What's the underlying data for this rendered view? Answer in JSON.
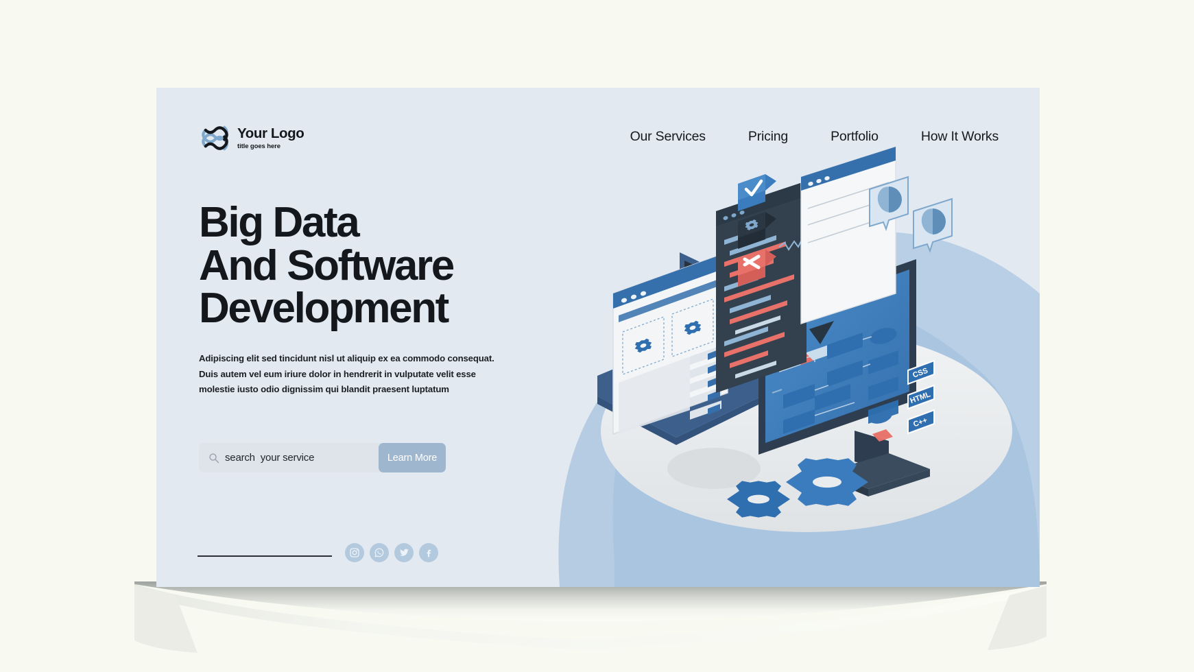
{
  "page": {
    "background_color": "#f8faf1",
    "card_color": "#e3e9f1"
  },
  "brand": {
    "logo_icon": "interlocking-loops-logo",
    "title": "Your Logo",
    "subtitle": "title goes here",
    "logo_color_light": "#7fa8cc",
    "logo_color_dark": "#14181c"
  },
  "nav": {
    "items": [
      {
        "label": "Our Services"
      },
      {
        "label": "Pricing"
      },
      {
        "label": "Portfolio"
      },
      {
        "label": "How It Works"
      }
    ]
  },
  "hero": {
    "title_lines": [
      "Big Data",
      "And Software",
      "Development"
    ],
    "description": "Adipiscing elit sed  tincidunt nisl ut aliquip ex ea commodo consequat. Duis autem vel eum iriure dolor in hendrerit in vulputate velit esse molestie iusto odio dignissim qui blandit praesent luptatum",
    "search": {
      "icon": "search-icon",
      "placeholder": "search  your service",
      "value": "",
      "button_label": "Learn More",
      "button_color": "#9fb6cf",
      "field_color": "#dfe4ea"
    },
    "social": [
      {
        "name": "instagram",
        "label": "Instagram"
      },
      {
        "name": "whatsapp",
        "label": "WhatsApp"
      },
      {
        "name": "twitter",
        "label": "Twitter"
      },
      {
        "name": "facebook",
        "label": "Facebook"
      }
    ],
    "social_color": "#b3c9de",
    "divider_color": "#2b3038"
  },
  "illustration": {
    "name": "isometric-software-development-scene",
    "blob_back_color": "#b9cfe5",
    "blob_front_color": "#a6c2de",
    "desk_color": "#e9ecee",
    "monitor_frame_color": "#2e3d4f",
    "monitor_screen_color": "#3a7cbe",
    "laptop_color": "#3c5f8c",
    "code_window_color": "#33414f",
    "gear_color": "#3a7cbe",
    "accent_red": "#e8716a",
    "badges": [
      {
        "label": "CSS"
      },
      {
        "label": "HTML"
      },
      {
        "label": "C++"
      }
    ],
    "floating_icons": [
      {
        "name": "check-badge-icon",
        "color": "#3a7cbe"
      },
      {
        "name": "gear-bug-badge-icon",
        "color": "#2b3844"
      },
      {
        "name": "close-badge-icon",
        "color": "#e8716a"
      }
    ],
    "chat_bubbles": 2
  }
}
